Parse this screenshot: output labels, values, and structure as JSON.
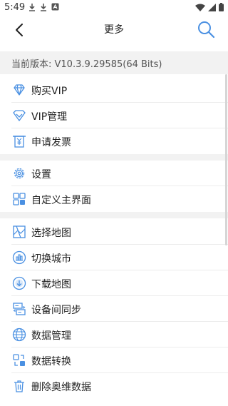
{
  "status_bar": {
    "time": "5:49",
    "left_icons": [
      "download-icon",
      "download-icon",
      "notification-icon"
    ],
    "right_icons": [
      "wifi-icon",
      "cellular-icon",
      "battery-icon"
    ]
  },
  "nav": {
    "title": "更多",
    "back_icon": "back-arrow-icon",
    "search_icon": "search-icon"
  },
  "version": {
    "text": "当前版本: V10.3.9.29585(64 Bits)"
  },
  "menu_groups": [
    {
      "items": [
        {
          "label": "购买VIP",
          "icon": "diamond-icon"
        },
        {
          "label": "VIP管理",
          "icon": "vip-badge-icon"
        },
        {
          "label": "申请发票",
          "icon": "invoice-icon"
        }
      ]
    },
    {
      "items": [
        {
          "label": "设置",
          "icon": "gear-icon"
        },
        {
          "label": "自定义主界面",
          "icon": "grid-layout-icon"
        }
      ]
    },
    {
      "items": [
        {
          "label": "选择地图",
          "icon": "map-icon"
        },
        {
          "label": "切换城市",
          "icon": "city-icon"
        },
        {
          "label": "下载地图",
          "icon": "download-circle-icon"
        },
        {
          "label": "设备间同步",
          "icon": "sync-icon"
        },
        {
          "label": "数据管理",
          "icon": "globe-icon"
        },
        {
          "label": "数据转换",
          "icon": "convert-icon"
        },
        {
          "label": "删除奥维数据",
          "icon": "trash-icon"
        }
      ]
    }
  ],
  "colors": {
    "accent": "#4a90e2",
    "section_bg": "#f2f2f2",
    "divider": "#ececec"
  }
}
